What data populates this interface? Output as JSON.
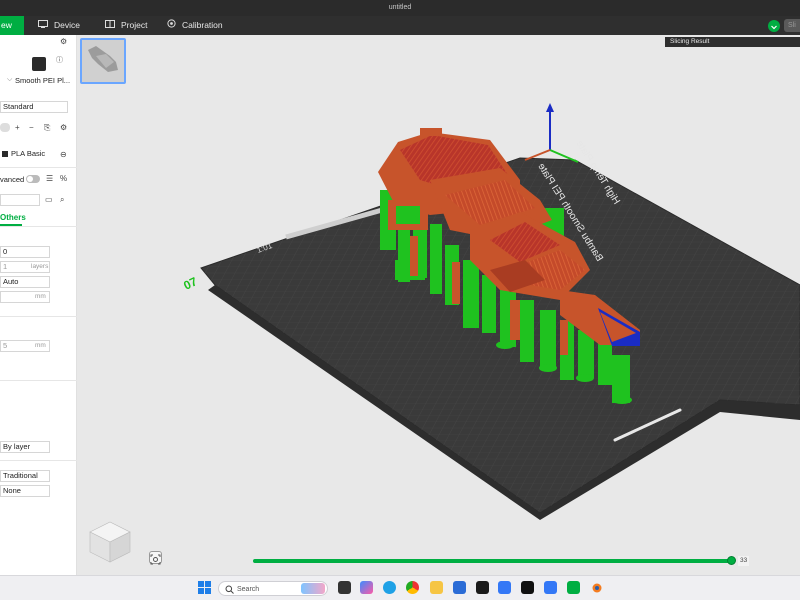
{
  "window": {
    "title": "untitled"
  },
  "nav": {
    "tabs": [
      {
        "label": "ew"
      },
      {
        "label": "Device"
      },
      {
        "label": "Project"
      },
      {
        "label": "Calibration"
      }
    ],
    "slice_label": "Sli"
  },
  "left_panel": {
    "plate_name": "Smooth PEI Pl...",
    "process_preset": "Standard",
    "filament_name": "PLA Basic",
    "advanced_label": "vanced",
    "others_tab": "Others",
    "fields": {
      "f1": "0",
      "f2": "1",
      "f2_unit": "layers",
      "f3": "Auto",
      "f4_unit": "mm",
      "f5": "5",
      "f5_unit": "mm",
      "by_layer": "By layer",
      "traditional": "Traditional",
      "none": "None"
    }
  },
  "viewport": {
    "slicing_result": "Slicing Result",
    "bed_label_left": "07",
    "bed_text_1": "Bambu Smooth PEI Plate",
    "bed_text_2": "High Temp Plate",
    "bed_text_3": "1:01",
    "layer_max": "33"
  },
  "progress": {
    "value": 1.0
  },
  "taskbar": {
    "search_placeholder": "Search"
  },
  "colors": {
    "accent": "#00ae42",
    "wall": "#c7542b",
    "infill": "#b8352a",
    "support": "#1fc21f",
    "axis_z": "#1a2cc4",
    "bed": "#3a3a3a"
  }
}
